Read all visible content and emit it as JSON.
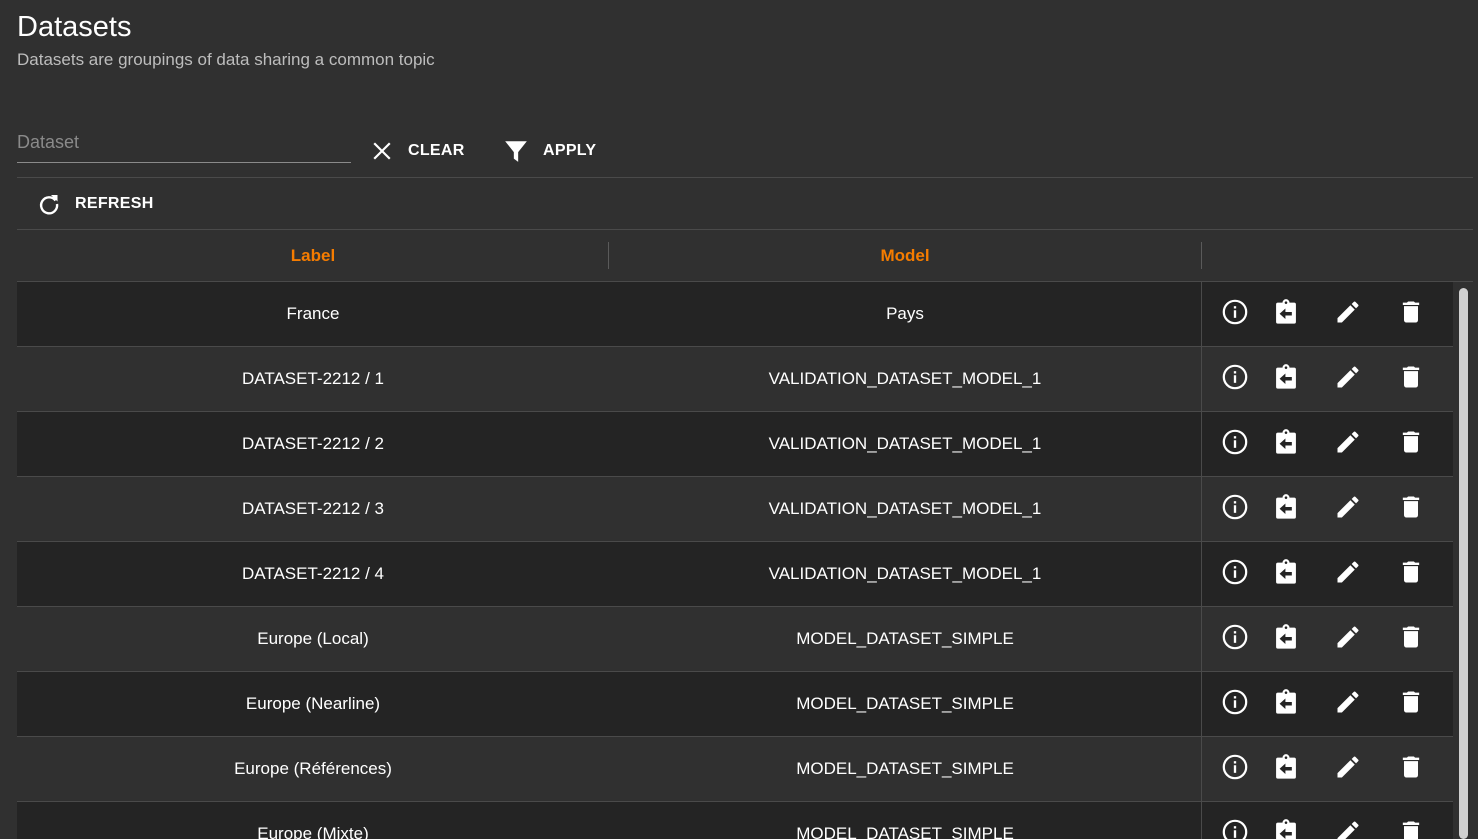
{
  "header": {
    "title": "Datasets",
    "subtitle": "Datasets are groupings of data sharing a common topic"
  },
  "filters": {
    "dataset_placeholder": "Dataset",
    "dataset_value": "",
    "clear_label": "CLEAR",
    "apply_label": "APPLY"
  },
  "toolbar": {
    "refresh_label": "REFRESH"
  },
  "table": {
    "columns": [
      "Label",
      "Model"
    ],
    "rows": [
      {
        "label": "France",
        "model": "Pays"
      },
      {
        "label": "DATASET-2212 / 1",
        "model": "VALIDATION_DATASET_MODEL_1"
      },
      {
        "label": "DATASET-2212 / 2",
        "model": "VALIDATION_DATASET_MODEL_1"
      },
      {
        "label": "DATASET-2212 / 3",
        "model": "VALIDATION_DATASET_MODEL_1"
      },
      {
        "label": "DATASET-2212 / 4",
        "model": "VALIDATION_DATASET_MODEL_1"
      },
      {
        "label": "Europe (Local)",
        "model": "MODEL_DATASET_SIMPLE"
      },
      {
        "label": "Europe (Nearline)",
        "model": "MODEL_DATASET_SIMPLE"
      },
      {
        "label": "Europe (Références)",
        "model": "MODEL_DATASET_SIMPLE"
      },
      {
        "label": "Europe (Mixte)",
        "model": "MODEL_DATASET_SIMPLE"
      }
    ],
    "row_actions": [
      "info-icon",
      "clipboard-restore-icon",
      "pencil-edit-icon",
      "trash-delete-icon"
    ]
  },
  "colors": {
    "background": "#303030",
    "row_dark": "#242424",
    "header_accent": "#f57c00",
    "text": "#ffffff",
    "subtitle": "#bdbdbd"
  }
}
